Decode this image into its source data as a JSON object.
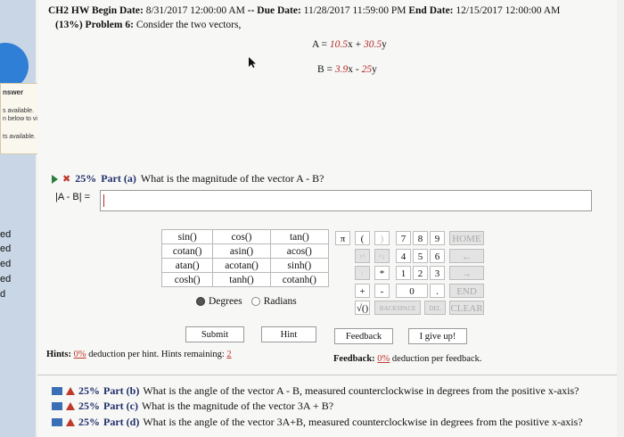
{
  "header": {
    "course": "CH2 HW",
    "begin_label": "Begin Date:",
    "begin_date": "8/31/2017 12:00:00 AM",
    "sep": "--",
    "due_label": "Due Date:",
    "due_date": "11/28/2017 11:59:00 PM",
    "end_label": "End Date:",
    "end_date": "12/15/2017 12:00:00 AM"
  },
  "problem": {
    "weight": "(13%)",
    "number": "Problem 6:",
    "text": "Consider the two vectors,"
  },
  "vectors": {
    "a_lhs": "A = ",
    "a_c1": "10.5",
    "a_m1": "x + ",
    "a_c2": "30.5",
    "a_m2": "y",
    "b_lhs": "B = ",
    "b_c1": "3.9",
    "b_m1": "x - ",
    "b_c2": "25",
    "b_m2": "y"
  },
  "sidebar": {
    "answer_title": "nswer",
    "line1": "s available.",
    "line2": "n below to view.",
    "line3": "ts available.",
    "ed_labels": [
      "ed",
      "ed",
      "ed",
      "ed",
      "d"
    ]
  },
  "part_a": {
    "pct": "25%",
    "part": "Part (a)",
    "question": "What is the magnitude of the vector A - B?",
    "label": "|A - B| ="
  },
  "functions": [
    [
      "sin()",
      "cos()",
      "tan()"
    ],
    [
      "cotan()",
      "asin()",
      "acos()"
    ],
    [
      "atan()",
      "acotan()",
      "sinh()"
    ],
    [
      "cosh()",
      "tanh()",
      "cotanh()"
    ]
  ],
  "angle_mode": {
    "degrees": "Degrees",
    "radians": "Radians",
    "selected": "Degrees"
  },
  "keypad": {
    "pi": "π",
    "lparen": "(",
    "rparen": ")",
    "k7": "7",
    "k8": "8",
    "k9": "9",
    "home": "HOME",
    "up": "↑^",
    "down": "^↓",
    "k4": "4",
    "k5": "5",
    "k6": "6",
    "left": "←",
    "div": "/",
    "mul": "*",
    "k1": "1",
    "k2": "2",
    "k3": "3",
    "right": "→",
    "plus": "+",
    "minus": "-",
    "k0": "0",
    "dot": ".",
    "end": "END",
    "sqrt": "√()",
    "backspace": "BACKSPACE",
    "del": "DEL",
    "clear": "CLEAR"
  },
  "buttons": {
    "submit": "Submit",
    "hint": "Hint",
    "feedback": "Feedback",
    "give_up": "I give up!"
  },
  "hints": {
    "label": "Hints:",
    "pct": "0%",
    "text": "deduction per hint. Hints remaining:",
    "remaining": "2"
  },
  "feedback_info": {
    "label": "Feedback:",
    "pct": "0%",
    "text": "deduction per feedback."
  },
  "other_parts": [
    {
      "pct": "25%",
      "part": "Part (b)",
      "question": "What is the angle of the vector A - B, measured counterclockwise in degrees from the positive x-axis?"
    },
    {
      "pct": "25%",
      "part": "Part (c)",
      "question": "What is the magnitude of the vector 3A + B?"
    },
    {
      "pct": "25%",
      "part": "Part (d)",
      "question": "What is the angle of the vector 3A+B, measured counterclockwise in degrees from the positive x-axis?"
    }
  ],
  "colors": {
    "accent_red": "#b22a2a",
    "part_blue": "#1f2f6a",
    "sidebar_blue": "#2f7fd6"
  }
}
